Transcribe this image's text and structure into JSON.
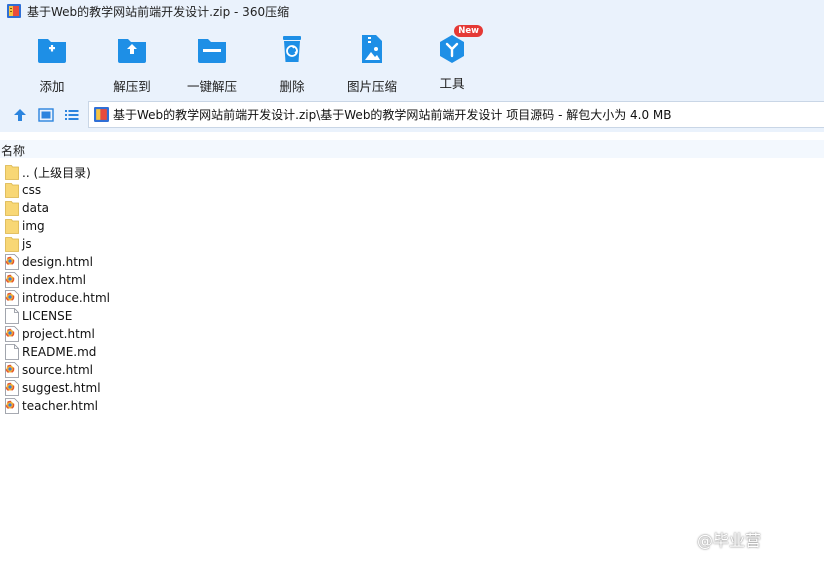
{
  "window": {
    "title": "基于Web的教学网站前端开发设计.zip - 360压缩"
  },
  "toolbar": {
    "items": [
      {
        "label": "添加",
        "icon": "add-folder-icon"
      },
      {
        "label": "解压到",
        "icon": "extract-to-icon"
      },
      {
        "label": "一键解压",
        "icon": "one-click-extract-icon"
      },
      {
        "label": "删除",
        "icon": "delete-icon"
      },
      {
        "label": "图片压缩",
        "icon": "image-compress-icon"
      },
      {
        "label": "工具",
        "icon": "tools-icon",
        "badge": "New"
      }
    ]
  },
  "address": {
    "path": "基于Web的教学网站前端开发设计.zip\\基于Web的教学网站前端开发设计 项目源码 - 解包大小为 4.0 MB"
  },
  "list": {
    "column_name": "名称",
    "items": [
      {
        "name": ".. (上级目录)",
        "type": "folder"
      },
      {
        "name": "css",
        "type": "folder"
      },
      {
        "name": "data",
        "type": "folder"
      },
      {
        "name": "img",
        "type": "folder"
      },
      {
        "name": "js",
        "type": "folder"
      },
      {
        "name": "design.html",
        "type": "html"
      },
      {
        "name": "index.html",
        "type": "html"
      },
      {
        "name": "introduce.html",
        "type": "html"
      },
      {
        "name": "LICENSE",
        "type": "file"
      },
      {
        "name": "project.html",
        "type": "html"
      },
      {
        "name": "README.md",
        "type": "file"
      },
      {
        "name": "source.html",
        "type": "html"
      },
      {
        "name": "suggest.html",
        "type": "html"
      },
      {
        "name": "teacher.html",
        "type": "html"
      }
    ]
  },
  "watermark": {
    "text": "@毕业营"
  },
  "colors": {
    "chrome_bg": "#eaf2fc",
    "accent_blue": "#1e8fe6",
    "folder_yellow": "#f8d775",
    "badge_red": "#e53935"
  }
}
